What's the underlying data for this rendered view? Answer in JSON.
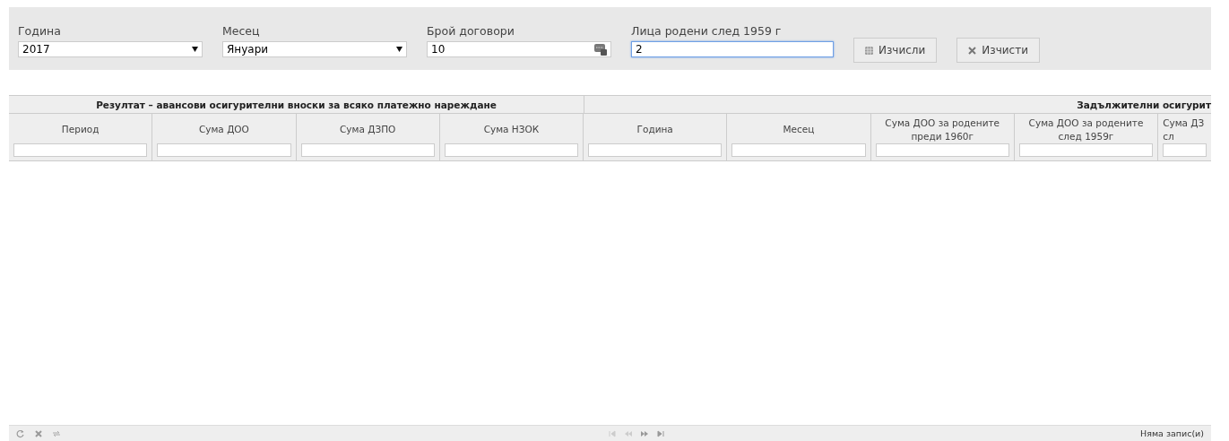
{
  "form": {
    "fields": [
      {
        "kind": "select",
        "label": "Година",
        "value": "2017",
        "focused": false
      },
      {
        "kind": "select",
        "label": "Месец",
        "value": "Януари",
        "focused": false
      },
      {
        "kind": "number",
        "label": "Брой договори",
        "value": "10",
        "focused": false
      },
      {
        "kind": "text",
        "label": "Лица родени след 1959 г",
        "value": "2",
        "focused": true
      }
    ],
    "buttons": [
      {
        "kind": "calc",
        "label": "Изчисли"
      },
      {
        "kind": "clear",
        "label": "Изчисти"
      }
    ]
  },
  "grid": {
    "groups": [
      {
        "title": "Резултат – авансови осигурителни вноски за всяко платежно нареждане",
        "columns": [
          {
            "lines": [
              "Период"
            ]
          },
          {
            "lines": [
              "Сума ДОО"
            ]
          },
          {
            "lines": [
              "Сума ДЗПО"
            ]
          },
          {
            "lines": [
              "Сума НЗОК"
            ]
          }
        ]
      },
      {
        "title": "Задължителни осигурит",
        "columns": [
          {
            "lines": [
              "Година"
            ]
          },
          {
            "lines": [
              "Месец"
            ]
          },
          {
            "lines": [
              "Сума ДОО за родените",
              "преди 1960г"
            ]
          },
          {
            "lines": [
              "Сума ДОО за родените",
              "след 1959г"
            ]
          },
          {
            "lines": [
              "Сума ДЗ",
              "сл"
            ]
          }
        ]
      }
    ]
  },
  "pager": {
    "status": "Няма запис(и)"
  }
}
